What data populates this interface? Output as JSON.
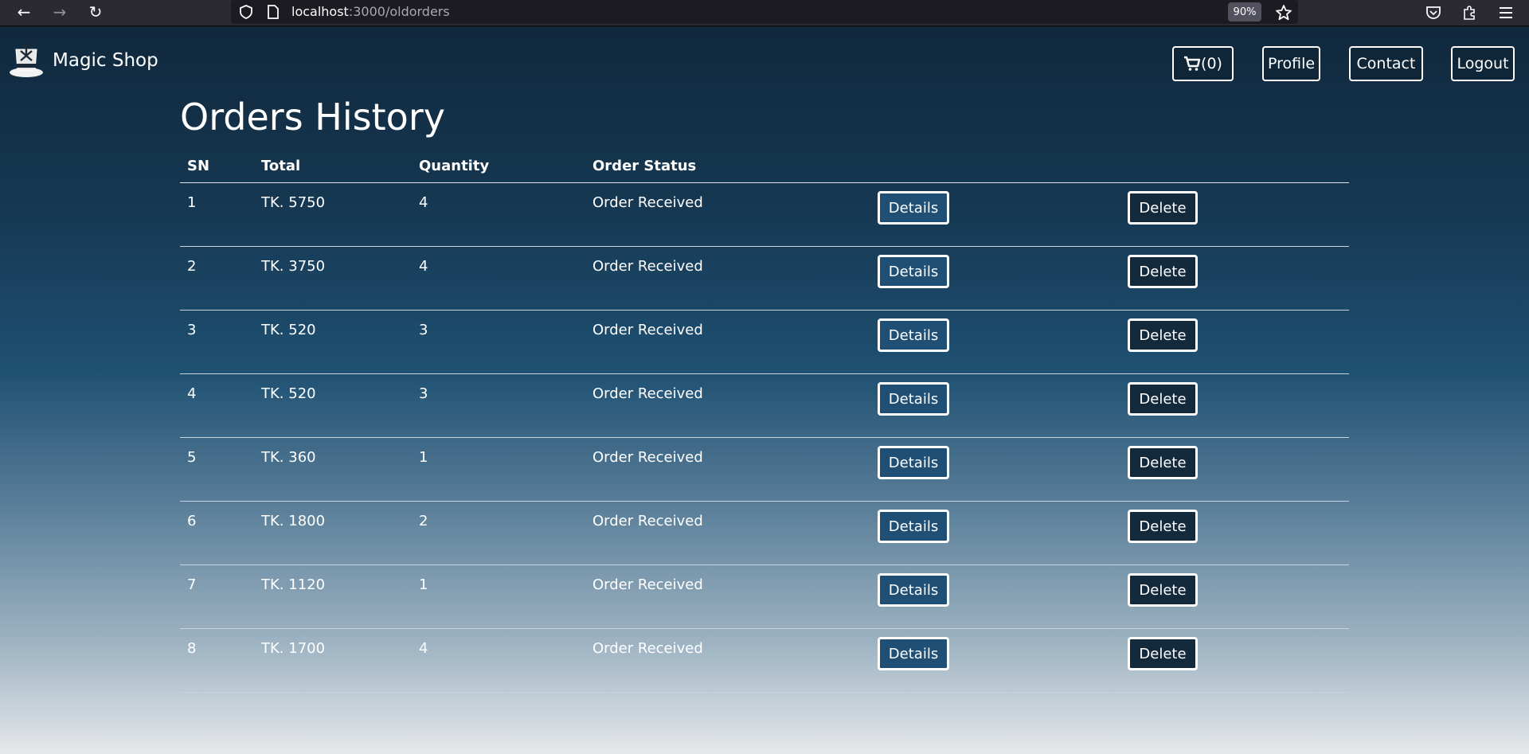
{
  "browser": {
    "url_host": "localhost",
    "url_path": ":3000/oldorders",
    "zoom": "90%",
    "icons": [
      "back-arrow-icon",
      "forward-arrow-icon",
      "reload-icon",
      "shield-icon",
      "page-icon",
      "bookmark-star-icon",
      "pocket-icon",
      "extensions-icon",
      "menu-icon"
    ]
  },
  "header": {
    "brand": "Magic Shop",
    "cart_label": "(0)",
    "profile_label": "Profile",
    "contact_label": "Contact",
    "logout_label": "Logout"
  },
  "main": {
    "title": "Orders History",
    "columns": [
      "SN",
      "Total",
      "Quantity",
      "Order Status"
    ],
    "rows": [
      {
        "sn": "1",
        "total": "TK. 5750",
        "quantity": "4",
        "status": "Order Received"
      },
      {
        "sn": "2",
        "total": "TK. 3750",
        "quantity": "4",
        "status": "Order Received"
      },
      {
        "sn": "3",
        "total": "TK. 520",
        "quantity": "3",
        "status": "Order Received"
      },
      {
        "sn": "4",
        "total": "TK. 520",
        "quantity": "3",
        "status": "Order Received"
      },
      {
        "sn": "5",
        "total": "TK. 360",
        "quantity": "1",
        "status": "Order Received"
      },
      {
        "sn": "6",
        "total": "TK. 1800",
        "quantity": "2",
        "status": "Order Received"
      },
      {
        "sn": "7",
        "total": "TK. 1120",
        "quantity": "1",
        "status": "Order Received"
      },
      {
        "sn": "8",
        "total": "TK. 1700",
        "quantity": "4",
        "status": "Order Received"
      }
    ],
    "details_label": "Details",
    "delete_label": "Delete"
  }
}
